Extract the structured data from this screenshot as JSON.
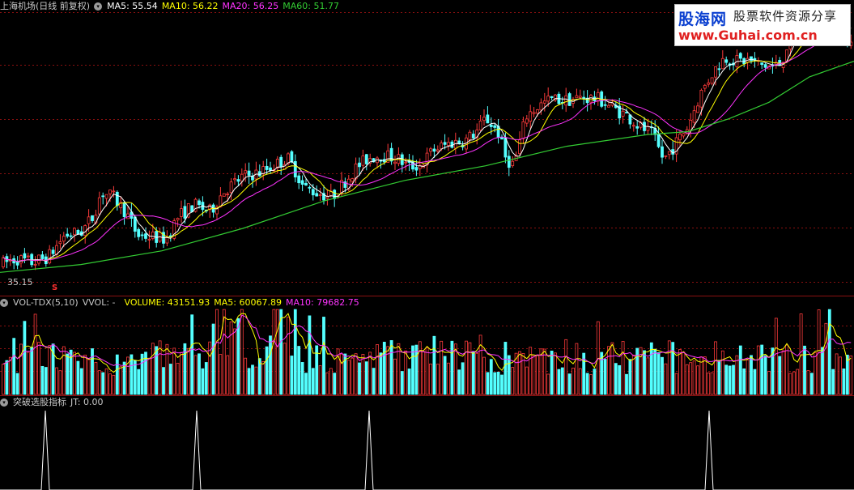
{
  "main_header": {
    "title": "上海机场(日线 前复权)",
    "ma5": "MA5: 55.54",
    "ma10": "MA10: 56.22",
    "ma20": "MA20: 56.25",
    "ma60": "MA60: 51.77"
  },
  "vol_header": {
    "title": "VOL-TDX(5,10)",
    "vvol": "VVOL: -",
    "volume": "VOLUME: 43151.93",
    "ma5": "MA5: 60067.89",
    "ma10": "MA10: 79682.75"
  },
  "ind_header": {
    "title": "突破选股指标",
    "jt": "JT: 0.00"
  },
  "low_marker": {
    "label": "35.15",
    "mark": "S"
  },
  "logo": {
    "line1": "股海网",
    "line2": "股票软件资源分享",
    "line3": "www.Guhai.com.cn"
  },
  "colors": {
    "up": "#ff3b3b",
    "down": "#54ffff",
    "ma5": "#ffffff",
    "ma10": "#ffff00",
    "ma20": "#ff33ff",
    "ma60": "#33cc33",
    "grid": "#8a1010"
  },
  "chart_data": [
    {
      "type": "candlestick",
      "title": "上海机场(日线 前复权)",
      "low_label": 35.15,
      "ylim": [
        33,
        62
      ],
      "series": [
        {
          "name": "MA5",
          "last": 55.54
        },
        {
          "name": "MA10",
          "last": 56.22
        },
        {
          "name": "MA20",
          "last": 56.25
        },
        {
          "name": "MA60",
          "last": 51.77
        }
      ],
      "close_trend": [
        [
          0,
          35.6
        ],
        [
          20,
          36.2
        ],
        [
          40,
          35.8
        ],
        [
          60,
          36.4
        ],
        [
          80,
          38.6
        ],
        [
          100,
          38.9
        ],
        [
          115,
          40.5
        ],
        [
          125,
          43.0
        ],
        [
          140,
          42.5
        ],
        [
          155,
          41.0
        ],
        [
          170,
          38.6
        ],
        [
          190,
          38.4
        ],
        [
          205,
          38.2
        ],
        [
          220,
          40.5
        ],
        [
          240,
          41.7
        ],
        [
          260,
          41.0
        ],
        [
          275,
          43.0
        ],
        [
          300,
          44.6
        ],
        [
          320,
          45.0
        ],
        [
          340,
          45.8
        ],
        [
          355,
          46.5
        ],
        [
          365,
          45.2
        ],
        [
          375,
          43.5
        ],
        [
          390,
          43.0
        ],
        [
          410,
          42.5
        ],
        [
          425,
          44.0
        ],
        [
          440,
          45.5
        ],
        [
          455,
          46.5
        ],
        [
          470,
          46.8
        ],
        [
          490,
          46.5
        ],
        [
          505,
          45.6
        ],
        [
          520,
          45.8
        ],
        [
          535,
          47.3
        ],
        [
          555,
          48.0
        ],
        [
          575,
          48.3
        ],
        [
          590,
          49.3
        ],
        [
          600,
          50.6
        ],
        [
          615,
          49.2
        ],
        [
          625,
          46.4
        ],
        [
          635,
          45.8
        ],
        [
          650,
          50.8
        ],
        [
          665,
          51.8
        ],
        [
          680,
          52.5
        ],
        [
          700,
          52.4
        ],
        [
          720,
          52.7
        ],
        [
          740,
          52.5
        ],
        [
          760,
          51.5
        ],
        [
          775,
          50.8
        ],
        [
          790,
          49.7
        ],
        [
          805,
          49.0
        ],
        [
          820,
          46.3
        ],
        [
          835,
          48.0
        ],
        [
          850,
          49.8
        ],
        [
          865,
          53.0
        ],
        [
          880,
          55.2
        ],
        [
          895,
          56.8
        ],
        [
          910,
          56.4
        ],
        [
          925,
          56.5
        ],
        [
          940,
          56.0
        ],
        [
          955,
          55.8
        ],
        [
          965,
          56.2
        ],
        [
          980,
          60.0
        ],
        [
          995,
          61.2
        ],
        [
          1010,
          60.8
        ],
        [
          1030,
          60.5
        ],
        [
          1050,
          58.2
        ]
      ],
      "ma60_trend": [
        [
          0,
          34.8
        ],
        [
          100,
          35.6
        ],
        [
          200,
          37.0
        ],
        [
          300,
          39.3
        ],
        [
          400,
          42.1
        ],
        [
          500,
          44.2
        ],
        [
          600,
          45.7
        ],
        [
          700,
          47.7
        ],
        [
          800,
          48.9
        ],
        [
          850,
          49.2
        ],
        [
          900,
          50.5
        ],
        [
          950,
          52.2
        ],
        [
          1000,
          54.8
        ],
        [
          1055,
          56.4
        ]
      ]
    },
    {
      "type": "bar",
      "title": "VOL-TDX(5,10)",
      "series": [
        {
          "name": "VOLUME",
          "last": 43151.93
        },
        {
          "name": "MA5",
          "last": 60067.89
        },
        {
          "name": "MA10",
          "last": 79682.75
        }
      ],
      "ylim": [
        0,
        160000
      ]
    },
    {
      "type": "line",
      "title": "突破选股指标",
      "series": [
        {
          "name": "JT",
          "last": 0.0
        }
      ],
      "signal_x_positions": [
        56,
        243,
        456,
        876
      ],
      "ylim": [
        0,
        1
      ]
    }
  ]
}
